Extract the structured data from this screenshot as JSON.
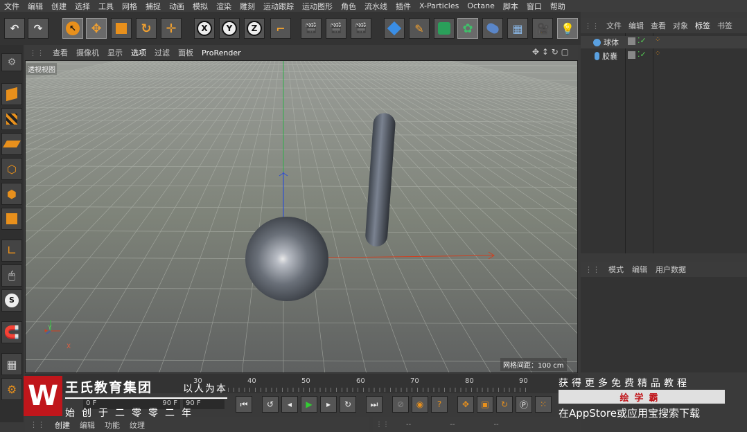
{
  "menubar": {
    "items": [
      "文件",
      "编辑",
      "创建",
      "选择",
      "工具",
      "网格",
      "捕捉",
      "动画",
      "模拟",
      "渲染",
      "雕刻",
      "运动跟踪",
      "运动图形",
      "角色",
      "流水线",
      "插件",
      "X-Particles",
      "Octane",
      "脚本",
      "窗口",
      "帮助"
    ]
  },
  "toolbar": {
    "axis_x": "X",
    "axis_y": "Y",
    "axis_z": "Z"
  },
  "viewport": {
    "menu": [
      "查看",
      "摄像机",
      "显示",
      "选项",
      "过滤",
      "面板",
      "ProRender"
    ],
    "view_label": "透视视图",
    "grid_spacing": "网格间距：100 cm",
    "axis_y": "Y",
    "axis_x": "X"
  },
  "objects_panel": {
    "menu": [
      "文件",
      "编辑",
      "查看",
      "对象",
      "标签",
      "书签"
    ],
    "objects": [
      {
        "name": "球体"
      },
      {
        "name": "胶囊"
      }
    ]
  },
  "attributes_panel": {
    "menu": [
      "模式",
      "编辑",
      "用户数据"
    ]
  },
  "timeline": {
    "ticks": [
      "30",
      "40",
      "50",
      "60",
      "70",
      "80",
      "90"
    ],
    "current_frame": "0 F",
    "start_frame": "0 F",
    "end_frame": "90 F",
    "end_frame2": "90 F"
  },
  "bottom_tabs": [
    "创建",
    "编辑",
    "功能",
    "纹理"
  ],
  "coord_dashes": [
    "--",
    "--",
    "--"
  ],
  "watermark": {
    "logo": "W",
    "company": "王氏教育集团",
    "slogan": "以人为本",
    "founded": "始创于二零零二年"
  },
  "ad": {
    "line1": "获得更多免费精品教程",
    "brand": "绘学霸",
    "line3": "在AppStore或应用宝搜索下载"
  }
}
